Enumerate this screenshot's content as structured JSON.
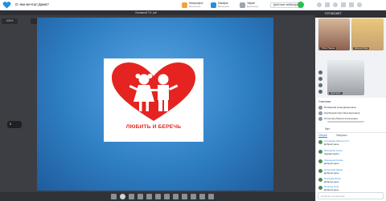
{
  "app": {
    "title": "О чем мечтал Дима?",
    "slide_name": "Основной Т.Н. pdf",
    "zoom": "100%",
    "page": "2"
  },
  "topbar": {
    "menu": [
      {
        "label": "Микрофон",
        "sub": "Выключен",
        "color": "#f2a33a"
      },
      {
        "label": "Камера",
        "sub": "Включена",
        "color": "#2a8cdf"
      },
      {
        "label": "Экран",
        "sub": "Выключен",
        "color": "#9aa5b1"
      }
    ],
    "control_label": "Действие вебинара",
    "badge_color": "#2dbf4e"
  },
  "slide": {
    "caption": "ЛЮБИТЬ И БЕРЕЧЬ",
    "heart_color": "#e52421"
  },
  "right_panel": {
    "title": "ГОТЧЕСКЕТ",
    "videos": [
      {
        "name": "Юлия Пакина"
      },
      {
        "name": "Евгения Лава"
      },
      {
        "name": "Анастасия"
      }
    ],
    "participants_header": "Участники",
    "participants": [
      "Батманова Анна Доморовна",
      "Журбунова Светлана Каушевна",
      "Оплетова Лариса Алексеевна"
    ]
  },
  "chat": {
    "title": "Чат",
    "tabs": [
      "Общий",
      "Вопросы"
    ],
    "messages": [
      {
        "who": "Соловьёва Ирина 12:47",
        "text": "Добрый день"
      },
      {
        "who": "Яблонская Ольга",
        "text": "Здравствуйте"
      },
      {
        "who": "Синицына Галина",
        "text": "Добрый день"
      },
      {
        "who": "Корнилова Ирина",
        "text": "Добрый день"
      },
      {
        "who": "Полякова Юлия",
        "text": "Добрый день"
      },
      {
        "who": "Петрова Анна",
        "text": "Добрый день"
      }
    ],
    "input_placeholder": "Написать сообщение"
  }
}
